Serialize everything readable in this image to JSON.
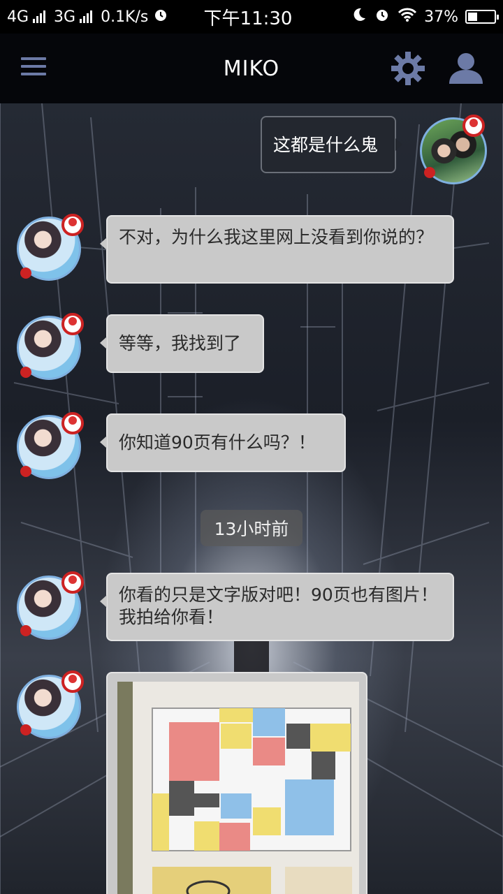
{
  "status_bar": {
    "left_text": "4G",
    "network2": "3G",
    "speed": "0.1K/s",
    "time": "下午11:30",
    "battery": "37%",
    "battery_level": 0.37
  },
  "app_bar": {
    "title": "MIKO",
    "icons": [
      "menu-icon",
      "gear-icon",
      "user-icon"
    ],
    "icon_color": "#6c7aa6"
  },
  "messages": [
    {
      "side": "out",
      "text": "这都是什么鬼"
    },
    {
      "side": "in",
      "text": "不对，为什么我这里网上没看到你说的？"
    },
    {
      "side": "in",
      "text": "等等，我找到了"
    },
    {
      "side": "in",
      "text": "你知道90页有什么吗？！"
    },
    {
      "side": "in",
      "text": "你看的只是文字版对吧！90页也有图片！我拍给你看！"
    },
    {
      "side": "in",
      "type": "image"
    }
  ],
  "timestamp": "13小时前",
  "colors": {
    "bubble_in": "#c9c9c9",
    "bubble_out": "#23272f",
    "accent": "#6c7aa6"
  }
}
